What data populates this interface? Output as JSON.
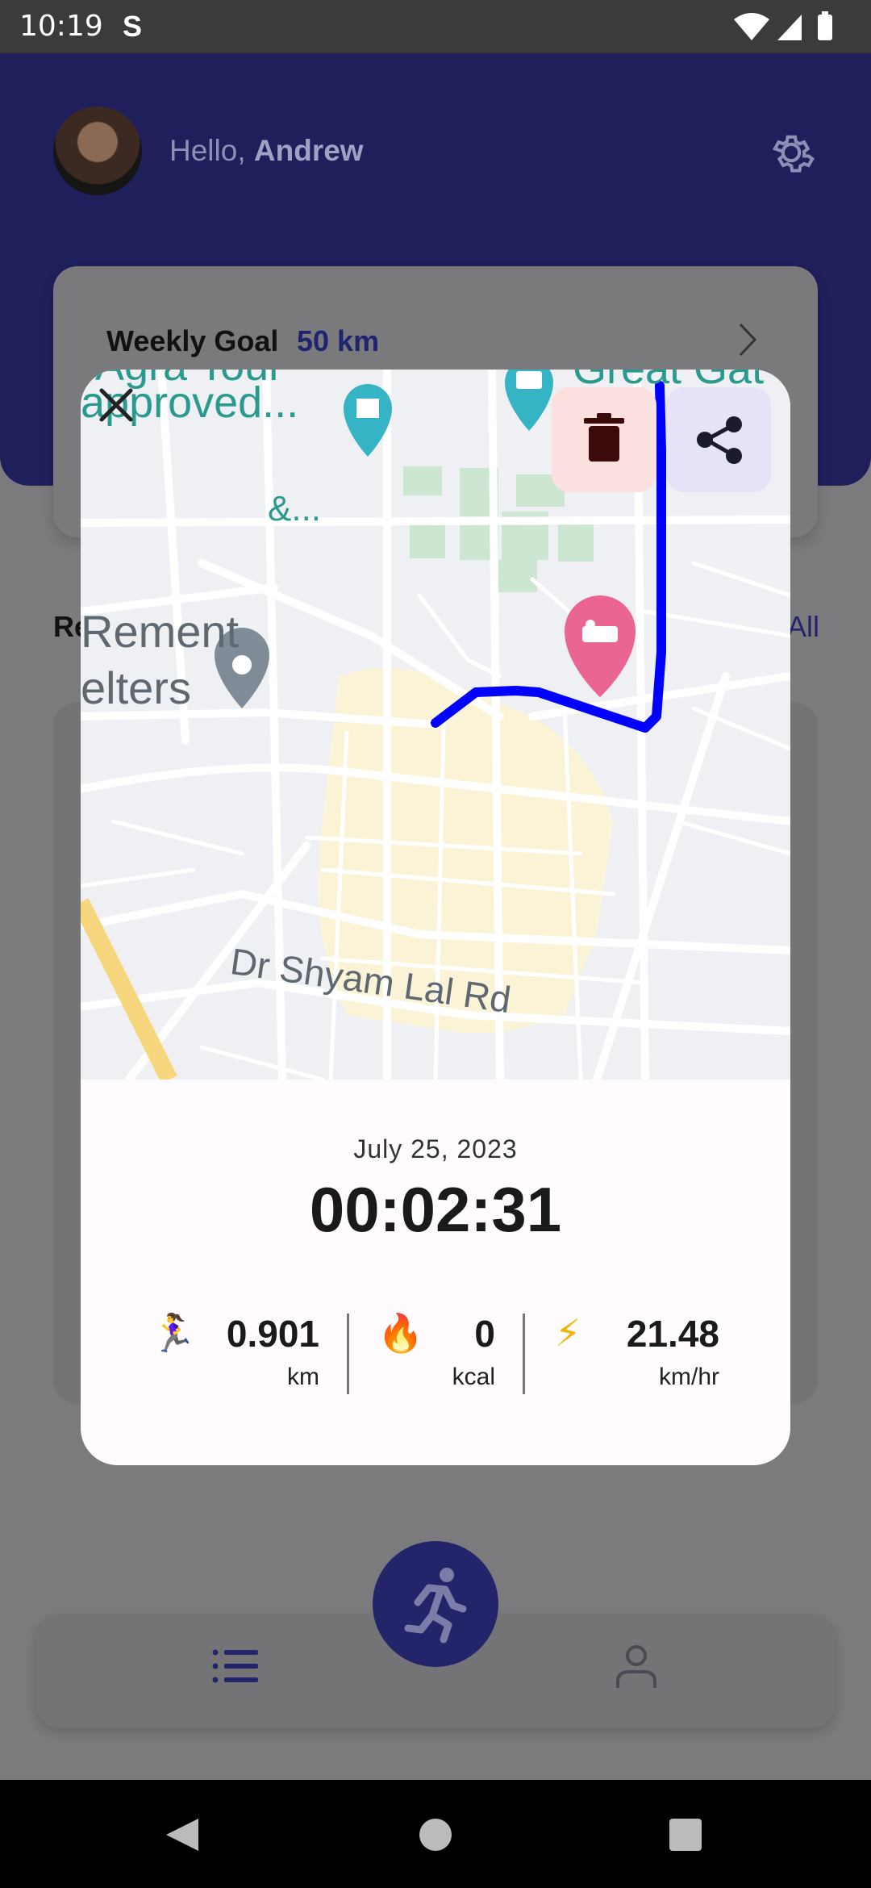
{
  "status_bar": {
    "time": "10:19",
    "app_indicator": "S"
  },
  "header": {
    "greeting": "Hello, ",
    "user_name": "Andrew"
  },
  "weekly_goal": {
    "label": "Weekly Goal",
    "value": "50 km"
  },
  "recent": {
    "title": "Re",
    "see_all": "All"
  },
  "map": {
    "labels": {
      "top_left_1": "Agra Tour",
      "top_left_2": "approved...",
      "amp": "&...",
      "great_gate": "Great Gat",
      "rement": "Rement",
      "elters": "elters",
      "road": "Dr Shyam Lal Rd"
    },
    "route_color": "#0000ff"
  },
  "activity": {
    "date": "July 25, 2023",
    "duration": "00:02:31",
    "distance": {
      "emoji": "🏃‍♀️",
      "value": "0.901",
      "unit": "km"
    },
    "calories": {
      "emoji": "🔥",
      "value": "0",
      "unit": "kcal"
    },
    "speed": {
      "emoji": "⚡",
      "value": "21.48",
      "unit": "km/hr"
    }
  },
  "colors": {
    "brand": "#24246a",
    "delete_bg": "#fce0e0",
    "share_bg": "#e4e3f8"
  }
}
